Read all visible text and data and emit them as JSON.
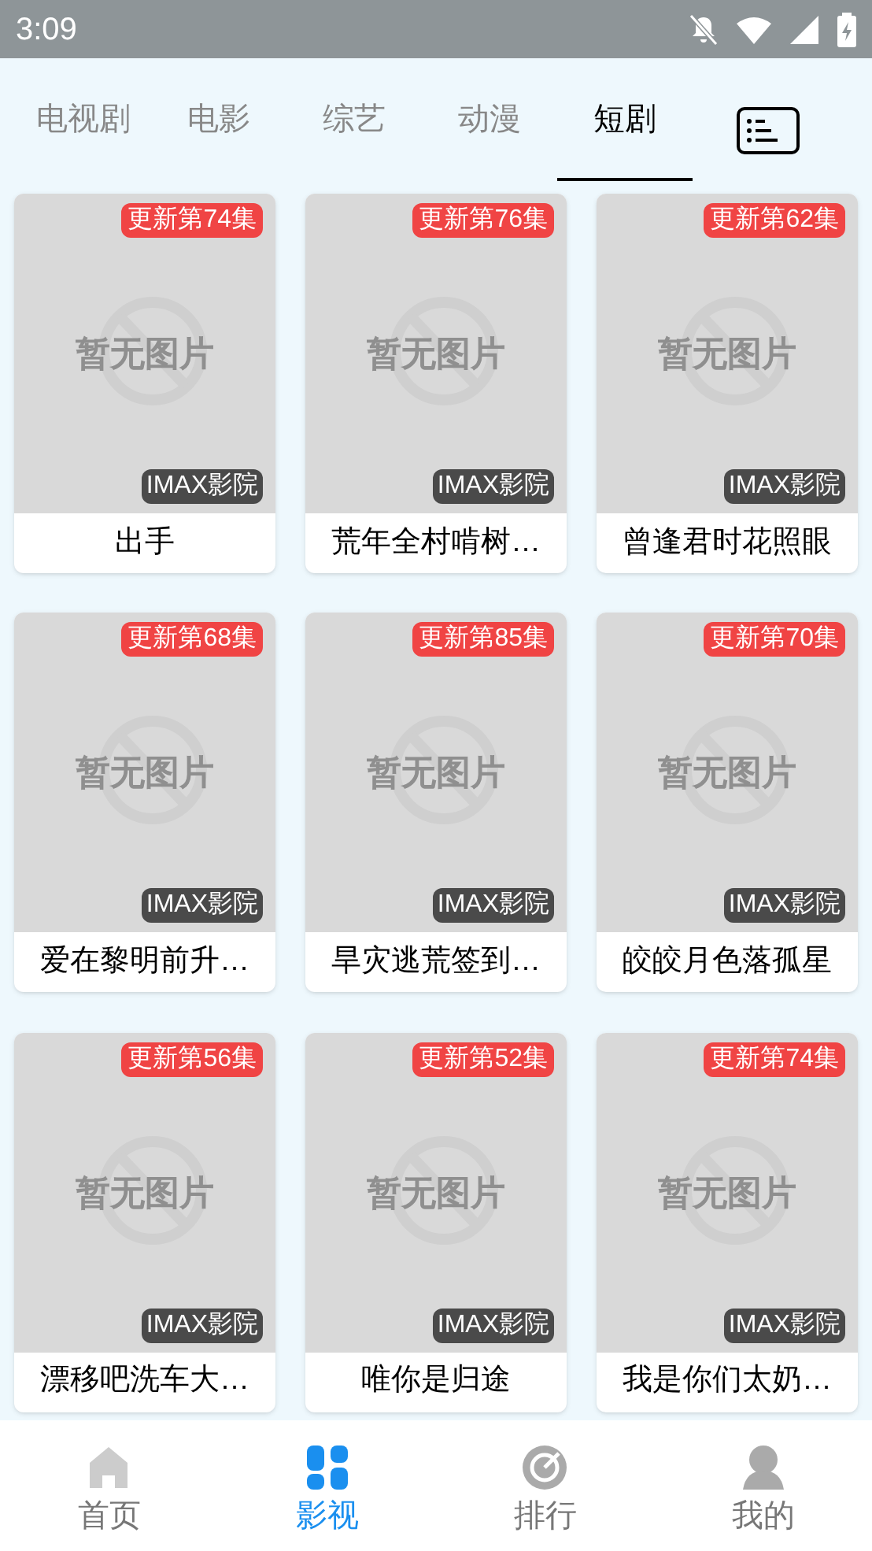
{
  "status_bar": {
    "time": "3:09"
  },
  "tabs": [
    {
      "label": "电视剧",
      "selected": false
    },
    {
      "label": "电影",
      "selected": false
    },
    {
      "label": "综艺",
      "selected": false
    },
    {
      "label": "动漫",
      "selected": false
    },
    {
      "label": "短剧",
      "selected": true
    }
  ],
  "cards": [
    {
      "badge": "更新第74集",
      "image_text": "暂无图片",
      "source": "IMAX影院",
      "title": "出手"
    },
    {
      "badge": "更新第76集",
      "image_text": "暂无图片",
      "source": "IMAX影院",
      "title": "荒年全村啃树…"
    },
    {
      "badge": "更新第62集",
      "image_text": "暂无图片",
      "source": "IMAX影院",
      "title": "曾逢君时花照眼"
    },
    {
      "badge": "更新第68集",
      "image_text": "暂无图片",
      "source": "IMAX影院",
      "title": "爱在黎明前升…"
    },
    {
      "badge": "更新第85集",
      "image_text": "暂无图片",
      "source": "IMAX影院",
      "title": "旱灾逃荒签到…"
    },
    {
      "badge": "更新第70集",
      "image_text": "暂无图片",
      "source": "IMAX影院",
      "title": "皎皎月色落孤星"
    },
    {
      "badge": "更新第56集",
      "image_text": "暂无图片",
      "source": "IMAX影院",
      "title": "漂移吧洗车大…"
    },
    {
      "badge": "更新第52集",
      "image_text": "暂无图片",
      "source": "IMAX影院",
      "title": "唯你是归途"
    },
    {
      "badge": "更新第74集",
      "image_text": "暂无图片",
      "source": "IMAX影院",
      "title": "我是你们太奶…"
    }
  ],
  "bottom_nav": [
    {
      "kind": "home",
      "label": "首页",
      "selected": false
    },
    {
      "kind": "grid",
      "label": "影视",
      "selected": true
    },
    {
      "kind": "rank",
      "label": "排行",
      "selected": false
    },
    {
      "kind": "user",
      "label": "我的",
      "selected": false
    }
  ]
}
